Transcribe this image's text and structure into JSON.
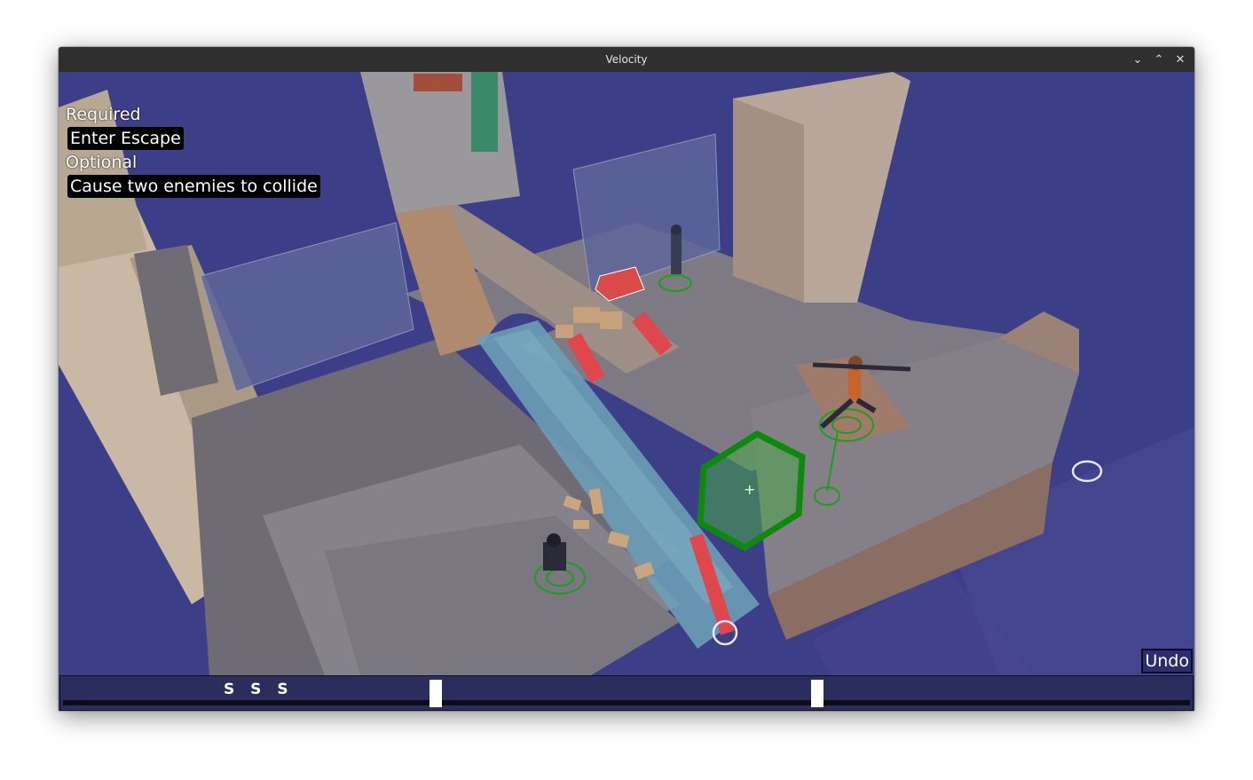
{
  "window": {
    "title": "Velocity",
    "controls": [
      "minimize-icon",
      "maximize-icon",
      "close-icon"
    ]
  },
  "objectives": {
    "required_heading": "Required",
    "required_items": [
      "Enter Escape"
    ],
    "optional_heading": "Optional",
    "optional_items": [
      "Cause two enemies to collide"
    ]
  },
  "undo": {
    "label": "Undo"
  },
  "timeline": {
    "speed_label": "S S S",
    "markers": 2
  },
  "colors": {
    "sky": "#3d3e88",
    "stone": "#7b7881",
    "water": "#6b9fb6",
    "enemy_ring": "#1aa01a",
    "target_hex": "#0d8a0d",
    "hazard": "#e0474c"
  }
}
